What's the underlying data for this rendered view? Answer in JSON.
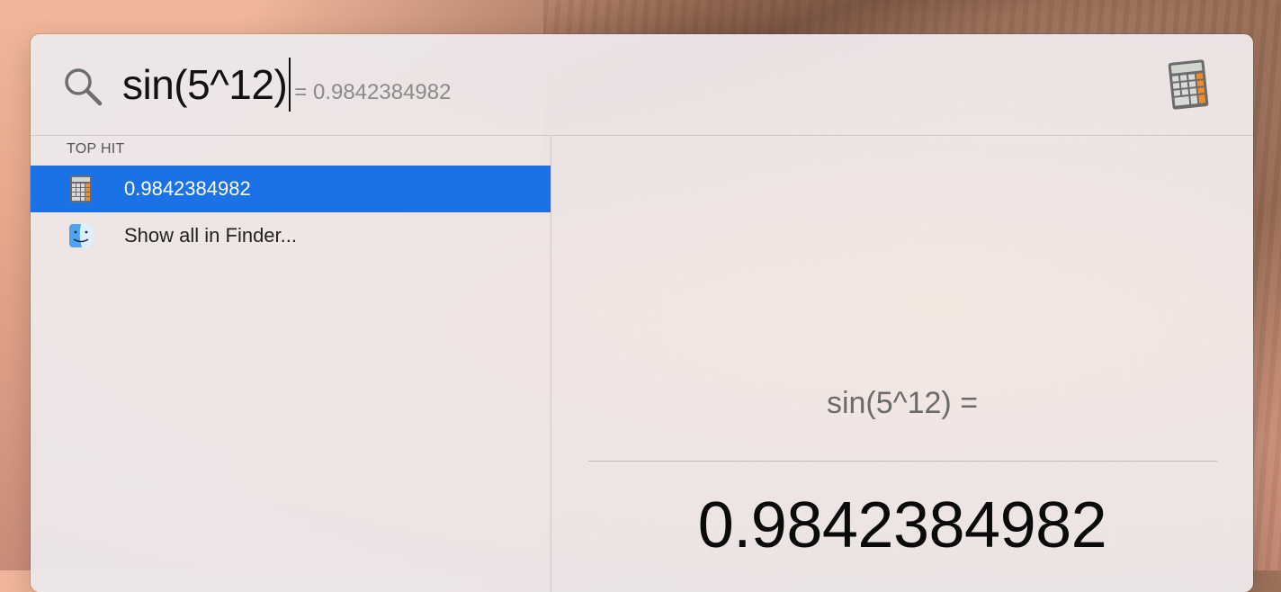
{
  "spotlight": {
    "query": "sin(5^12)",
    "inline_result": "= 0.9842384982",
    "search_icon": "search-icon",
    "top_app_icon": "calculator-icon"
  },
  "results": {
    "section_header": "TOP HIT",
    "items": [
      {
        "label": "0.9842384982",
        "icon": "calculator-icon",
        "selected": true
      },
      {
        "label": "Show all in Finder...",
        "icon": "finder-icon",
        "selected": false
      }
    ]
  },
  "preview": {
    "expression": "sin(5^12) =",
    "result": "0.9842384982"
  },
  "colors": {
    "selection": "#1a72e6"
  }
}
